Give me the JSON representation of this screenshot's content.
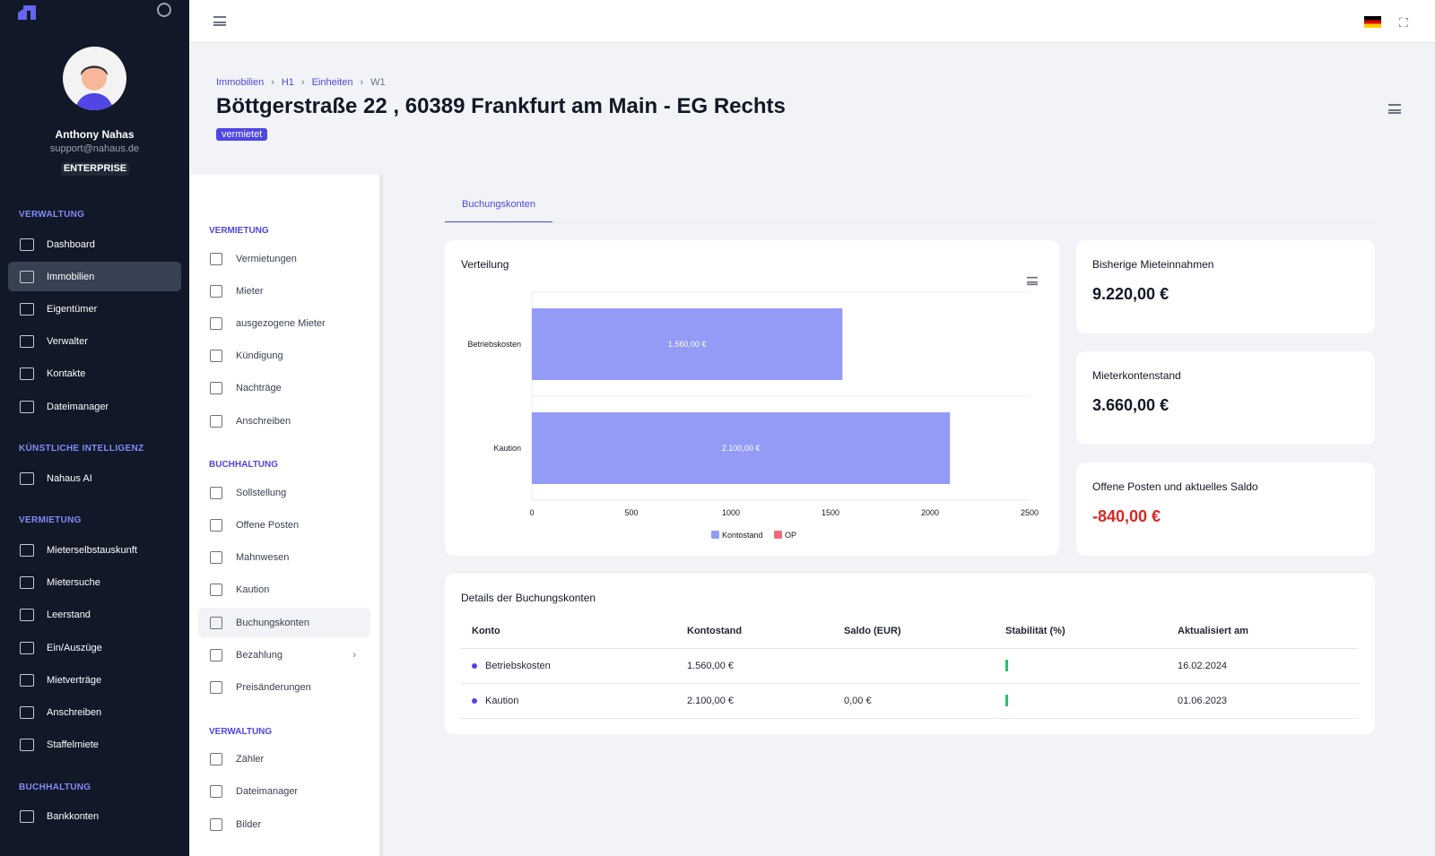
{
  "user": {
    "name": "Anthony Nahas",
    "email": "support@nahaus.de",
    "plan": "ENTERPRISE"
  },
  "sidebar": {
    "sections": [
      {
        "title": "VERWALTUNG",
        "items": [
          "Dashboard",
          "Immobilien",
          "Eigentümer",
          "Verwalter",
          "Kontakte",
          "Dateimanager"
        ]
      },
      {
        "title": "KÜNSTLICHE INTELLIGENZ",
        "items": [
          "Nahaus AI"
        ]
      },
      {
        "title": "VERMIETUNG",
        "items": [
          "Mieterselbstauskunft",
          "Mietersuche",
          "Leerstand",
          "Ein/Auszüge",
          "Mietverträge",
          "Anschreiben",
          "Staffelmiete"
        ]
      },
      {
        "title": "BUCHHALTUNG",
        "items": [
          "Bankkonten"
        ]
      }
    ]
  },
  "breadcrumb": [
    "Immobilien",
    "H1",
    "Einheiten",
    "W1"
  ],
  "page": {
    "title": "Böttgerstraße 22 , 60389 Frankfurt am Main - EG Rechts",
    "status": "vermietet"
  },
  "submenu": {
    "sections": [
      {
        "title": "VERMIETUNG",
        "items": [
          "Vermietungen",
          "Mieter",
          "ausgezogene Mieter",
          "Kündigung",
          "Nachträge",
          "Anschreiben"
        ]
      },
      {
        "title": "BUCHHALTUNG",
        "items": [
          "Sollstellung",
          "Offene Posten",
          "Mahnwesen",
          "Kaution",
          "Buchungskonten",
          "Bezahlung",
          "Preisänderungen"
        ]
      },
      {
        "title": "VERWALTUNG",
        "items": [
          "Zähler",
          "Dateimanager",
          "Bilder"
        ]
      }
    ]
  },
  "tab": "Buchungskonten",
  "stats": [
    {
      "label": "Bisherige Mieteinnahmen",
      "value": "9.220,00 €"
    },
    {
      "label": "Mieterkontenstand",
      "value": "3.660,00 €"
    },
    {
      "label": "Offene Posten und aktuelles Saldo",
      "value": "-840,00 €",
      "color": "#dc2626"
    }
  ],
  "chart_data": {
    "type": "bar",
    "orientation": "horizontal",
    "title": "Verteilung",
    "categories": [
      "Betriebskosten",
      "Kaution"
    ],
    "series": [
      {
        "name": "Kontostand",
        "values": [
          1560,
          2100
        ],
        "labels": [
          "1.560,00 €",
          "2.100,00 €"
        ],
        "color": "#939bf7"
      },
      {
        "name": "OP",
        "values": [
          0,
          0
        ],
        "color": "#f06a7e"
      }
    ],
    "xlim": [
      0,
      2500
    ],
    "xticks": [
      "0",
      "500",
      "1000",
      "1500",
      "2000",
      "2500"
    ],
    "legend": "bottom-center"
  },
  "table": {
    "title": "Details der Buchungskonten",
    "headers": [
      "Konto",
      "Kontostand",
      "Saldo (EUR)",
      "Stabilität (%)",
      "Aktualisiert am"
    ],
    "rows": [
      [
        "Betriebskosten",
        "1.560,00 €",
        "",
        "",
        "16.02.2024"
      ],
      [
        "Kaution",
        "2.100,00 €",
        "0,00 €",
        "",
        "01.06.2023"
      ]
    ]
  }
}
